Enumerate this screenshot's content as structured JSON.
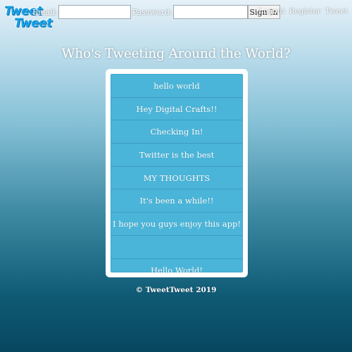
{
  "logo": {
    "line1": "Tweet",
    "line2": "Tweet"
  },
  "login": {
    "email_label": "Email:",
    "email_value": "",
    "password_label": "Password:",
    "password_value": "",
    "signin_label": "Sign In"
  },
  "nav": {
    "logout": "Logout",
    "register": "Register",
    "tweet": "Tweet"
  },
  "page_title": "Who's Tweeting Around the World?",
  "tweets": [
    "hello world",
    "Hey Digital Crafts!!",
    "Checking In!",
    "Twitter is the best",
    "MY THOUGHTS",
    "It's been a while!!",
    "I hope you guys enjoy this app!",
    "",
    "Hello World!"
  ],
  "footer": "© TweetTweet 2019"
}
